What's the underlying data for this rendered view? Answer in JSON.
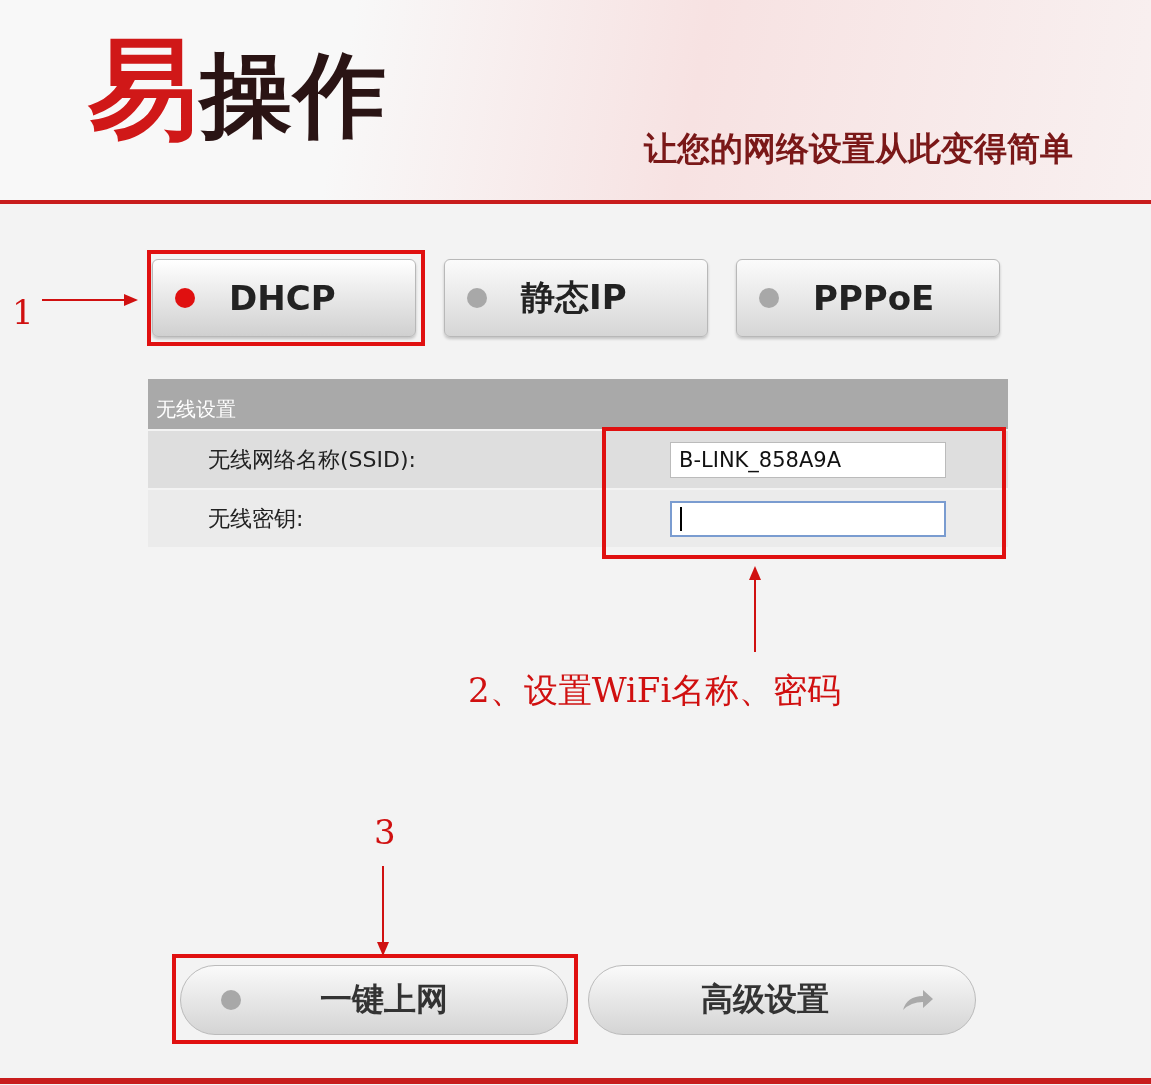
{
  "header": {
    "logo": "易操作",
    "slogan": "让您的网络设置从此变得简单"
  },
  "modes": [
    {
      "label": "DHCP",
      "selected": true
    },
    {
      "label": "静态IP",
      "selected": false
    },
    {
      "label": "PPPoE",
      "selected": false
    }
  ],
  "wireless": {
    "title": "无线设置",
    "fields": [
      {
        "label": "无线网络名称(SSID):",
        "value": "B-LINK_858A9A",
        "focused": false
      },
      {
        "label": "无线密钥:",
        "focused": true
      }
    ]
  },
  "actions": [
    {
      "label": "一键上网",
      "kind": "dot"
    },
    {
      "label": "高级设置",
      "kind": "arrow"
    }
  ],
  "annotations": {
    "step1": "1",
    "step2": "2、设置WiFi名称、密码",
    "step3": "3"
  }
}
